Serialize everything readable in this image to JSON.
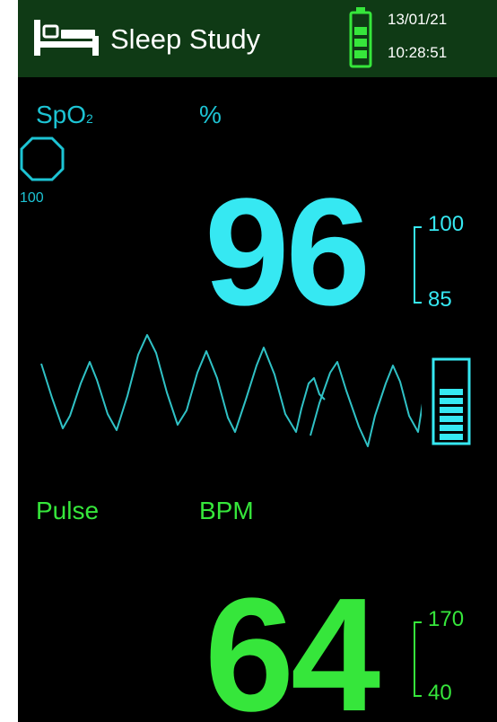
{
  "header": {
    "title": "Sleep Study",
    "date": "13/01/21",
    "time": "10:28:51",
    "icon": "bed-icon",
    "battery_icon": "battery-icon"
  },
  "spo2": {
    "label": "SpO",
    "label_sub": "2",
    "unit": "%",
    "value": "96",
    "alarm_high": "100",
    "alarm_low": "85",
    "alarm_level": "100",
    "indicator_icon": "octagon-icon",
    "color": "#36e8f2"
  },
  "pulse": {
    "label": "Pulse",
    "unit": "BPM",
    "value": "64",
    "alarm_high": "170",
    "alarm_low": "40",
    "color": "#36e63b"
  },
  "header_color": "#0f3a15"
}
